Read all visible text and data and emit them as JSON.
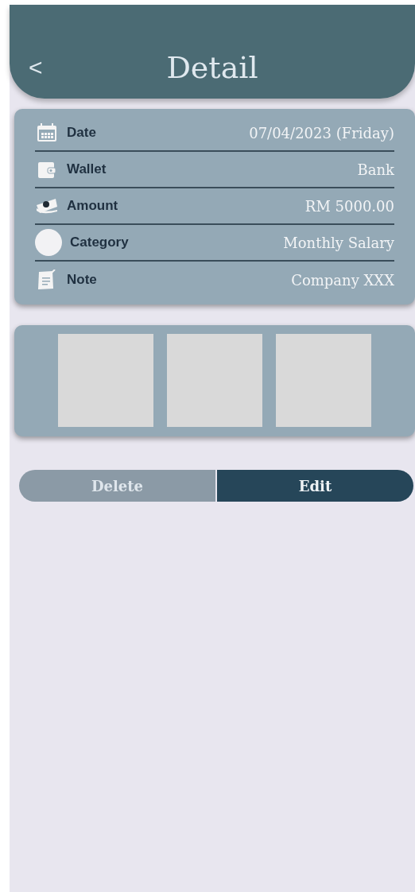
{
  "header": {
    "back": "<",
    "title": "Detail"
  },
  "fields": [
    {
      "kind": "calendar",
      "label": "Date",
      "value": "07/04/2023 (Friday)"
    },
    {
      "kind": "wallet",
      "label": "Wallet",
      "value": "Bank"
    },
    {
      "kind": "money",
      "label": "Amount",
      "value": "RM 5000.00"
    },
    {
      "kind": "circle",
      "label": "Category",
      "value": "Monthly Salary"
    },
    {
      "kind": "note",
      "label": "Note",
      "value": "Company XXX"
    }
  ],
  "images": [
    {
      "kind": "placeholder"
    },
    {
      "kind": "placeholder"
    },
    {
      "kind": "placeholder"
    }
  ],
  "buttons": [
    {
      "label": "Delete",
      "kind": "secondary"
    },
    {
      "label": "Edit",
      "kind": "primary"
    }
  ]
}
